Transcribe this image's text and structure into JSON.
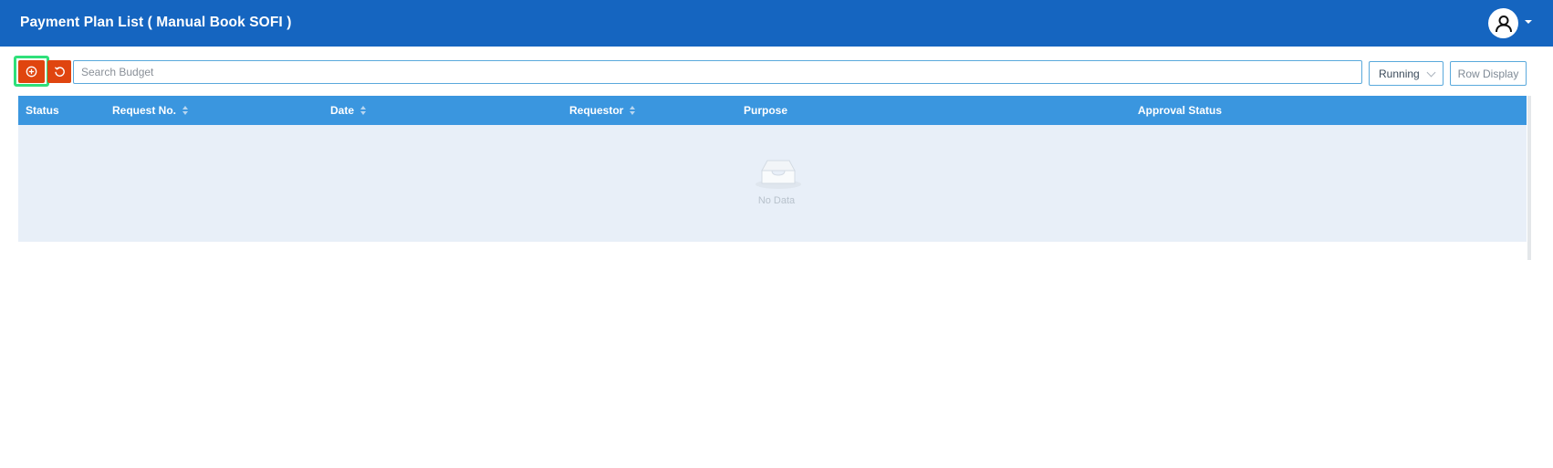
{
  "header": {
    "title": "Payment Plan List ( Manual Book SOFI )",
    "avatar_icon": "user-icon"
  },
  "toolbar": {
    "add_icon": "plus-circle-icon",
    "refresh_icon": "refresh-icon",
    "search_placeholder": "Search Budget",
    "status_filter": "Running",
    "row_display_label": "Row Display"
  },
  "table": {
    "columns": [
      {
        "label": "Status",
        "sortable": false
      },
      {
        "label": "Request No.",
        "sortable": true
      },
      {
        "label": "Date",
        "sortable": true
      },
      {
        "label": "Requestor",
        "sortable": true
      },
      {
        "label": "Purpose",
        "sortable": false
      },
      {
        "label": "Approval Status",
        "sortable": false
      }
    ],
    "rows": [],
    "empty_text": "No Data"
  },
  "colors": {
    "header_bg": "#1565c0",
    "table_header_bg": "#3a96df",
    "action_button": "#e0450f",
    "highlight": "#2fe07a",
    "empty_bg": "#e8eff8"
  }
}
